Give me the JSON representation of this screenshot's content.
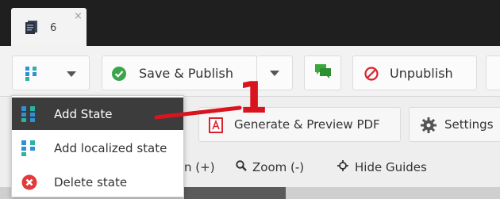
{
  "tab": {
    "number": "6",
    "close": "×"
  },
  "toolbar": {
    "save_publish": "Save & Publish",
    "unpublish": "Unpublish"
  },
  "row2": {
    "generate_pdf": "Generate & Preview PDF",
    "settings": "Settings"
  },
  "row3": {
    "zoom_in_partial": "n (+)",
    "zoom_out": "Zoom (-)",
    "hide_guides": "Hide Guides"
  },
  "menu": {
    "items": [
      {
        "label": "Add State",
        "icon": "states-icon",
        "active": true
      },
      {
        "label": "Add localized state",
        "icon": "localized-states-icon",
        "active": false
      },
      {
        "label": "Delete state",
        "icon": "delete-circle-icon",
        "active": false
      }
    ]
  },
  "annotation": {
    "number": "1",
    "color": "#d9141e"
  },
  "colors": {
    "accent_blue": "#2f8fd8",
    "teal": "#2bb3a0",
    "green_check": "#3aa54a",
    "chat_green": "#3aa83c",
    "unpublish_red": "#d9232e",
    "pdf_red": "#d9232e",
    "delete_red": "#e23a3a"
  }
}
